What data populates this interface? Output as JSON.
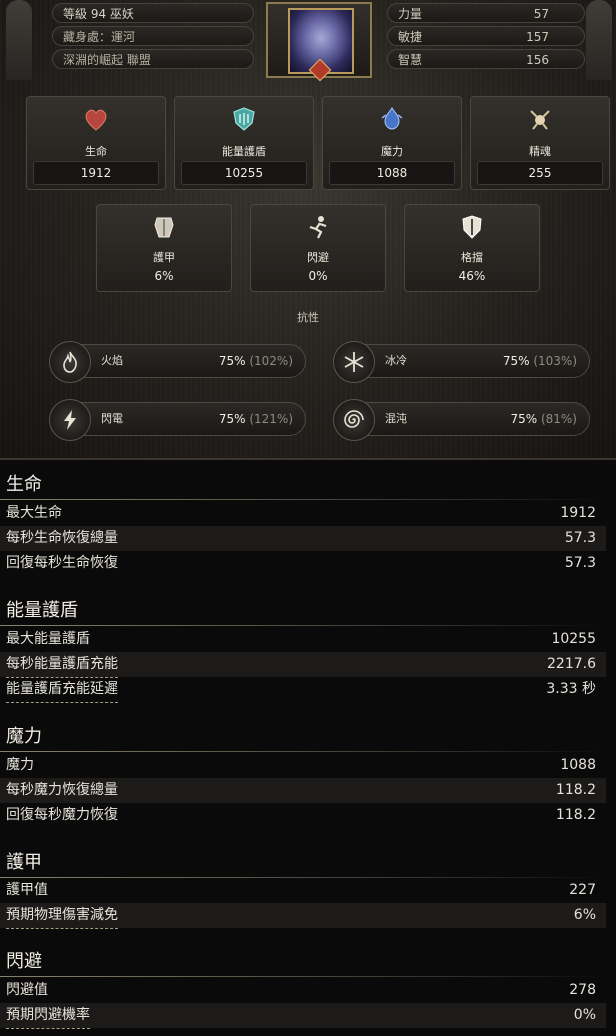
{
  "header": {
    "level_line": "等級 94 巫妖",
    "hideout_line": "藏身處：運河",
    "league_line": "深淵的崛起 聯盟",
    "attributes": [
      {
        "name": "力量",
        "value": "57"
      },
      {
        "name": "敏捷",
        "value": "157"
      },
      {
        "name": "智慧",
        "value": "156"
      }
    ]
  },
  "core_stats": [
    {
      "label": "生命",
      "value": "1912",
      "icon": "heart-icon"
    },
    {
      "label": "能量護盾",
      "value": "10255",
      "icon": "energy-shield-icon"
    },
    {
      "label": "魔力",
      "value": "1088",
      "icon": "mana-icon"
    },
    {
      "label": "精魂",
      "value": "255",
      "icon": "spirit-icon"
    }
  ],
  "defense_stats": [
    {
      "label": "護甲",
      "value": "6%",
      "icon": "armour-icon"
    },
    {
      "label": "閃避",
      "value": "0%",
      "icon": "evasion-icon"
    },
    {
      "label": "格擋",
      "value": "46%",
      "icon": "block-shield-icon"
    }
  ],
  "resistances": {
    "title": "抗性",
    "items": [
      {
        "name": "火焰",
        "value": "75%",
        "cap": "(102%)",
        "icon": "fire-icon"
      },
      {
        "name": "冰冷",
        "value": "75%",
        "cap": "(103%)",
        "icon": "snowflake-icon"
      },
      {
        "name": "閃電",
        "value": "75%",
        "cap": "(121%)",
        "icon": "lightning-icon"
      },
      {
        "name": "混沌",
        "value": "75%",
        "cap": "(81%)",
        "icon": "chaos-spiral-icon"
      }
    ]
  },
  "sections": [
    {
      "title": "生命",
      "rows": [
        {
          "label": "最大生命",
          "value": "1912"
        },
        {
          "label": "每秒生命恢復總量",
          "value": "57.3"
        },
        {
          "label": "回復每秒生命恢復",
          "value": "57.3"
        }
      ]
    },
    {
      "title": "能量護盾",
      "rows": [
        {
          "label": "最大能量護盾",
          "value": "10255"
        },
        {
          "label": "每秒能量護盾充能",
          "value": "2217.6"
        },
        {
          "label": "能量護盾充能延遲",
          "value": "3.33 秒"
        }
      ]
    },
    {
      "title": "魔力",
      "rows": [
        {
          "label": "魔力",
          "value": "1088"
        },
        {
          "label": "每秒魔力恢復總量",
          "value": "118.2"
        },
        {
          "label": "回復每秒魔力恢復",
          "value": "118.2"
        }
      ]
    },
    {
      "title": "護甲",
      "rows": [
        {
          "label": "護甲值",
          "value": "227"
        },
        {
          "label": "預期物理傷害減免",
          "value": "6%"
        }
      ]
    },
    {
      "title": "閃避",
      "rows": [
        {
          "label": "閃避值",
          "value": "278"
        },
        {
          "label": "預期閃避機率",
          "value": "0%"
        }
      ]
    }
  ]
}
